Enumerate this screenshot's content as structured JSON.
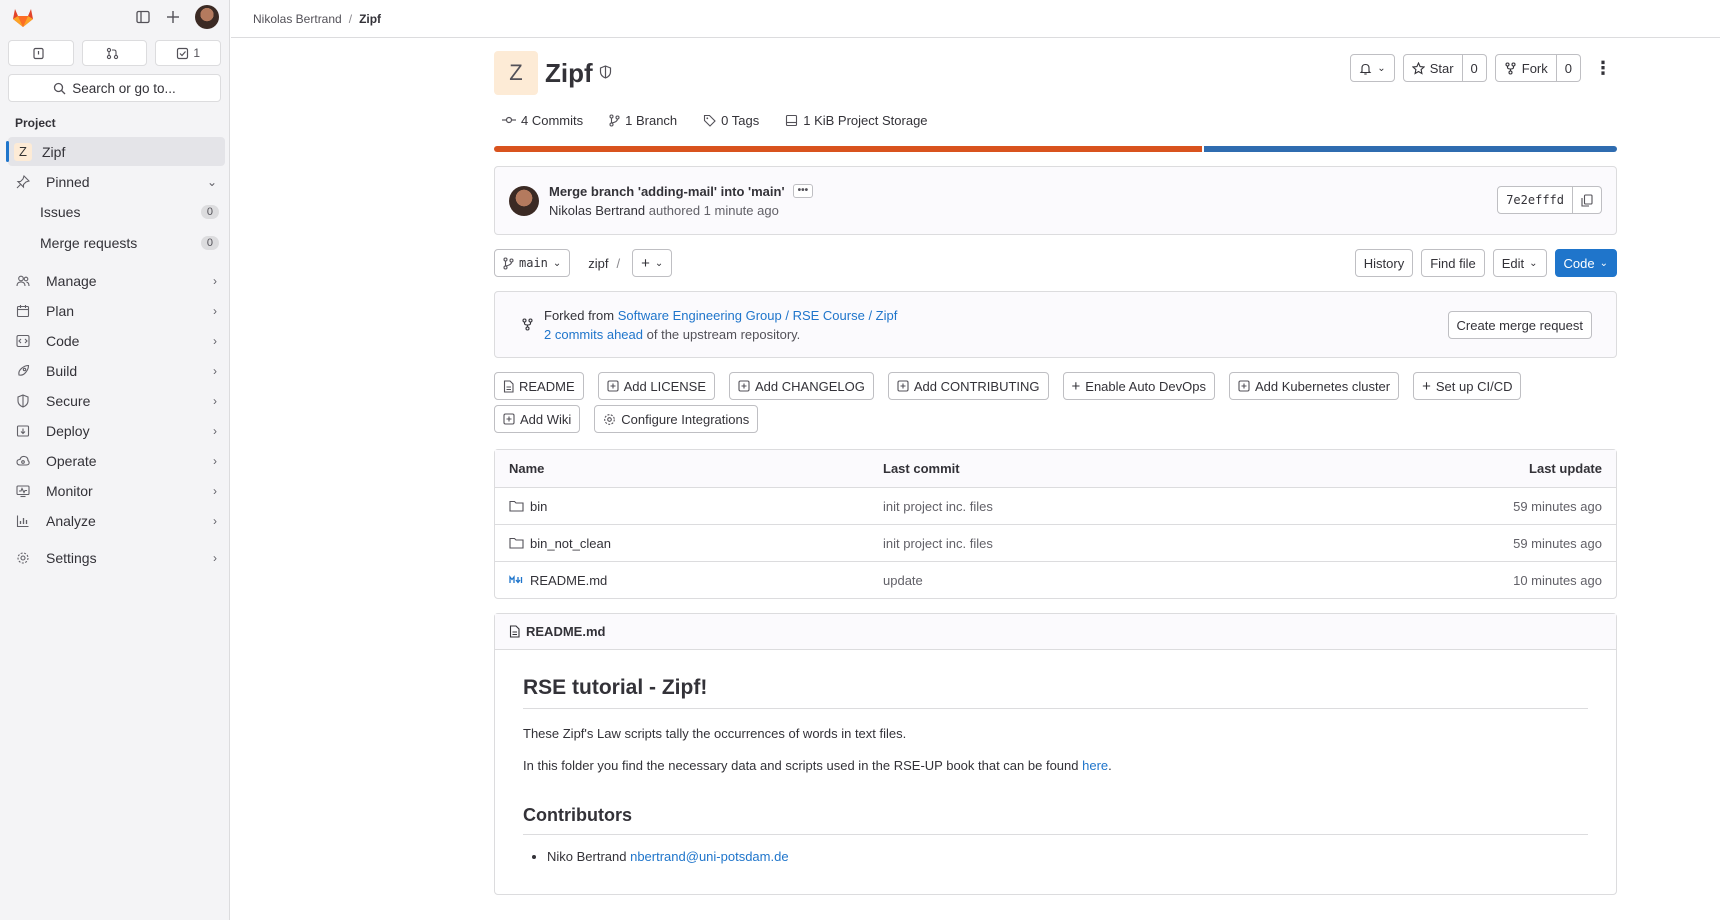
{
  "sidebar": {
    "counters": {
      "issues_count": "",
      "mr_count": "",
      "todos_count": "1"
    },
    "search_label": "Search or go to...",
    "section": "Project",
    "project": {
      "initial": "Z",
      "name": "Zipf"
    },
    "pinned": {
      "label": "Pinned",
      "items": [
        {
          "label": "Issues",
          "count": "0"
        },
        {
          "label": "Merge requests",
          "count": "0"
        }
      ]
    },
    "nav": [
      "Manage",
      "Plan",
      "Code",
      "Build",
      "Secure",
      "Deploy",
      "Operate",
      "Monitor",
      "Analyze"
    ],
    "settings": "Settings"
  },
  "breadcrumb": {
    "owner": "Nikolas Bertrand",
    "project": "Zipf"
  },
  "project": {
    "initial": "Z",
    "title": "Zipf",
    "star_label": "Star",
    "star_count": "0",
    "fork_label": "Fork",
    "fork_count": "0",
    "stats": {
      "commits": "4 Commits",
      "branches": "1 Branch",
      "tags": "0 Tags",
      "storage": "1 KiB Project Storage"
    },
    "storage_split": 0.632
  },
  "last_commit": {
    "title": "Merge branch 'adding-mail' into 'main'",
    "ellipsis": "•••",
    "author": "Nikolas Bertrand",
    "meta": "authored 1 minute ago",
    "sha": "7e2efffd"
  },
  "repo": {
    "branch": "main",
    "path": "zipf",
    "slash": "/",
    "history": "History",
    "find_file": "Find file",
    "edit": "Edit",
    "code": "Code"
  },
  "fork": {
    "prefix": "Forked from",
    "source": "Software Engineering Group / RSE Course / Zipf",
    "ahead_link": "2 commits ahead",
    "ahead_suffix": "of the upstream repository.",
    "create_mr": "Create merge request"
  },
  "quick_actions": [
    "README",
    "Add LICENSE",
    "Add CHANGELOG",
    "Add CONTRIBUTING",
    "Enable Auto DevOps",
    "Add Kubernetes cluster",
    "Set up CI/CD",
    "Add Wiki",
    "Configure Integrations"
  ],
  "files": {
    "headers": {
      "name": "Name",
      "commit": "Last commit",
      "update": "Last update"
    },
    "rows": [
      {
        "name": "bin",
        "commit": "init project inc. files",
        "update": "59 minutes ago"
      },
      {
        "name": "bin_not_clean",
        "commit": "init project inc. files",
        "update": "59 minutes ago"
      },
      {
        "name": "README.md",
        "commit": "update",
        "update": "10 minutes ago"
      }
    ]
  },
  "readme": {
    "filename": "README.md",
    "h1": "RSE tutorial - Zipf!",
    "p1": "These Zipf's Law scripts tally the occurrences of words in text files.",
    "p2_prefix": "In this folder you find the necessary data and scripts used in the RSE-UP book that can be found ",
    "p2_link": "here",
    "p2_suffix": ".",
    "h2": "Contributors",
    "contributor_name": "Niko Bertrand ",
    "contributor_email": "nbertrand@uni-potsdam.de"
  },
  "colors": {
    "accent": "#1f75cb",
    "storage_orange": "#d9531e",
    "storage_blue": "#2f6cb0"
  }
}
